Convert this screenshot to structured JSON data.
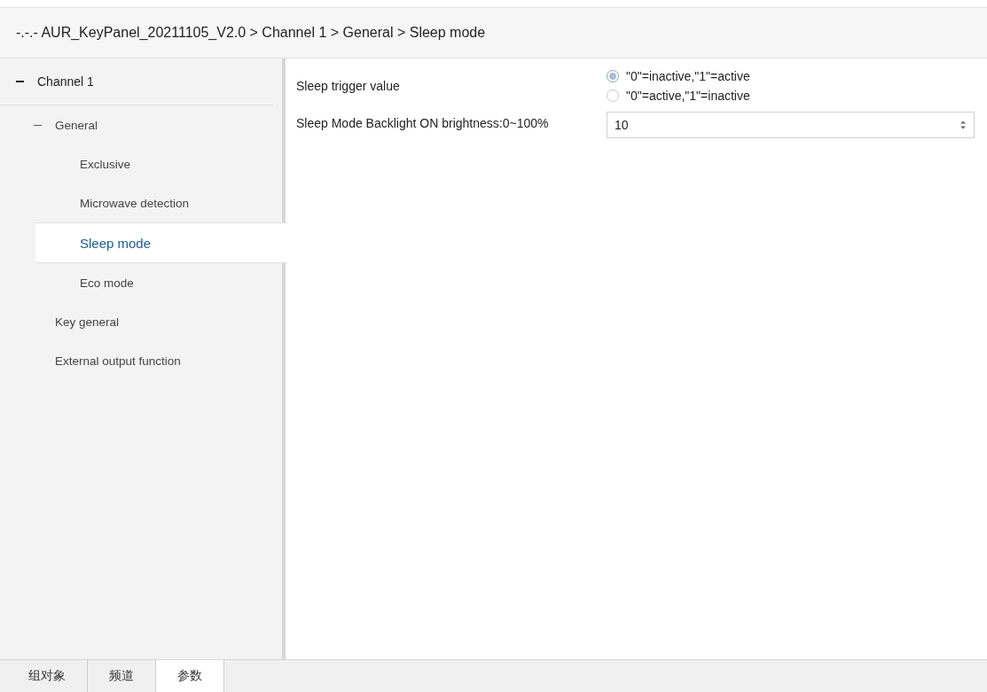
{
  "breadcrumb": "-.-.- AUR_KeyPanel_20211105_V2.0 > Channel 1 > General > Sleep mode",
  "tree": {
    "label": "Channel 1",
    "expanded": true,
    "children": [
      {
        "label": "General",
        "expanded": true,
        "selected": false,
        "children": [
          {
            "label": "Exclusive",
            "selected": false
          },
          {
            "label": "Microwave detection",
            "selected": false
          },
          {
            "label": "Sleep mode",
            "selected": true
          },
          {
            "label": "Eco mode",
            "selected": false
          }
        ]
      },
      {
        "label": "Key general",
        "selected": false
      },
      {
        "label": "External output function",
        "selected": false
      }
    ]
  },
  "parameters": [
    {
      "kind": "radio",
      "label": "Sleep trigger value",
      "options": [
        {
          "label": "\"0\"=inactive,\"1\"=active",
          "selected": true
        },
        {
          "label": "\"0\"=active,\"1\"=inactive",
          "selected": false
        }
      ]
    },
    {
      "kind": "spin",
      "label": "Sleep Mode Backlight ON brightness:0~100%",
      "value": "10"
    }
  ],
  "bottom_tabs": [
    {
      "label": "组对象",
      "selected": false
    },
    {
      "label": "频道",
      "selected": false
    },
    {
      "label": "参数",
      "selected": true
    }
  ]
}
